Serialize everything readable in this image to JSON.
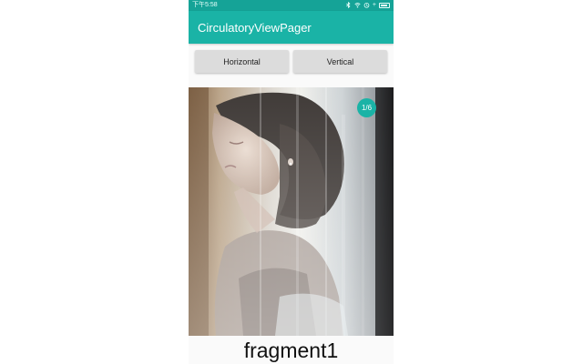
{
  "statusbar": {
    "time": "下午5:58",
    "icons": [
      "bluetooth-icon",
      "wifi-icon",
      "alarm-icon",
      "battery-icon"
    ],
    "battery_plus": "+"
  },
  "app": {
    "title": "CirculatoryViewPager",
    "primary_color": "#1ab3a6",
    "status_color": "#15a397"
  },
  "buttons": {
    "horizontal": "Horizontal",
    "vertical": "Vertical"
  },
  "pager": {
    "indicator": "1/6",
    "page_label": "fragment1",
    "image": "portrait-photo"
  }
}
